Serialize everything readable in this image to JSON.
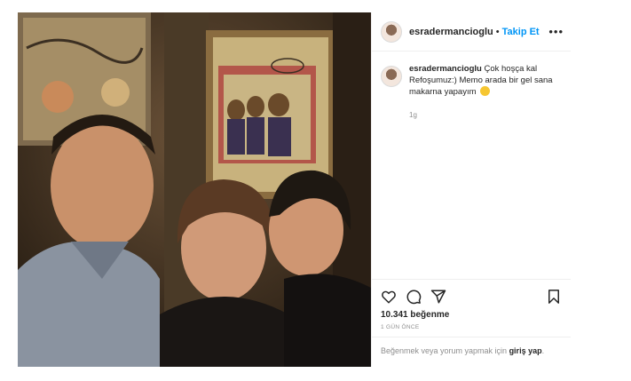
{
  "post": {
    "username": "esradermancioglu",
    "separator": "•",
    "follow_label": "Takip Et",
    "more_label": "•••",
    "caption": {
      "username": "esradermancioglu",
      "text": "Çok hoşça kal Refoşumuz:) Memo arada bir gel sana makarna yapayım",
      "time": "1g"
    },
    "likes": "10.341 beğenme",
    "date": "1 GÜN ÖNCE",
    "login_prompt": {
      "prefix": "Beğenmek veya yorum yapmak için ",
      "link": "giriş yap",
      "suffix": "."
    },
    "icons": [
      "heart-icon",
      "comment-icon",
      "share-icon",
      "bookmark-icon"
    ],
    "colors": {
      "follow_blue": "#0095f6",
      "muted": "#8e8e8e",
      "text": "#262626",
      "border": "#efefef"
    }
  }
}
